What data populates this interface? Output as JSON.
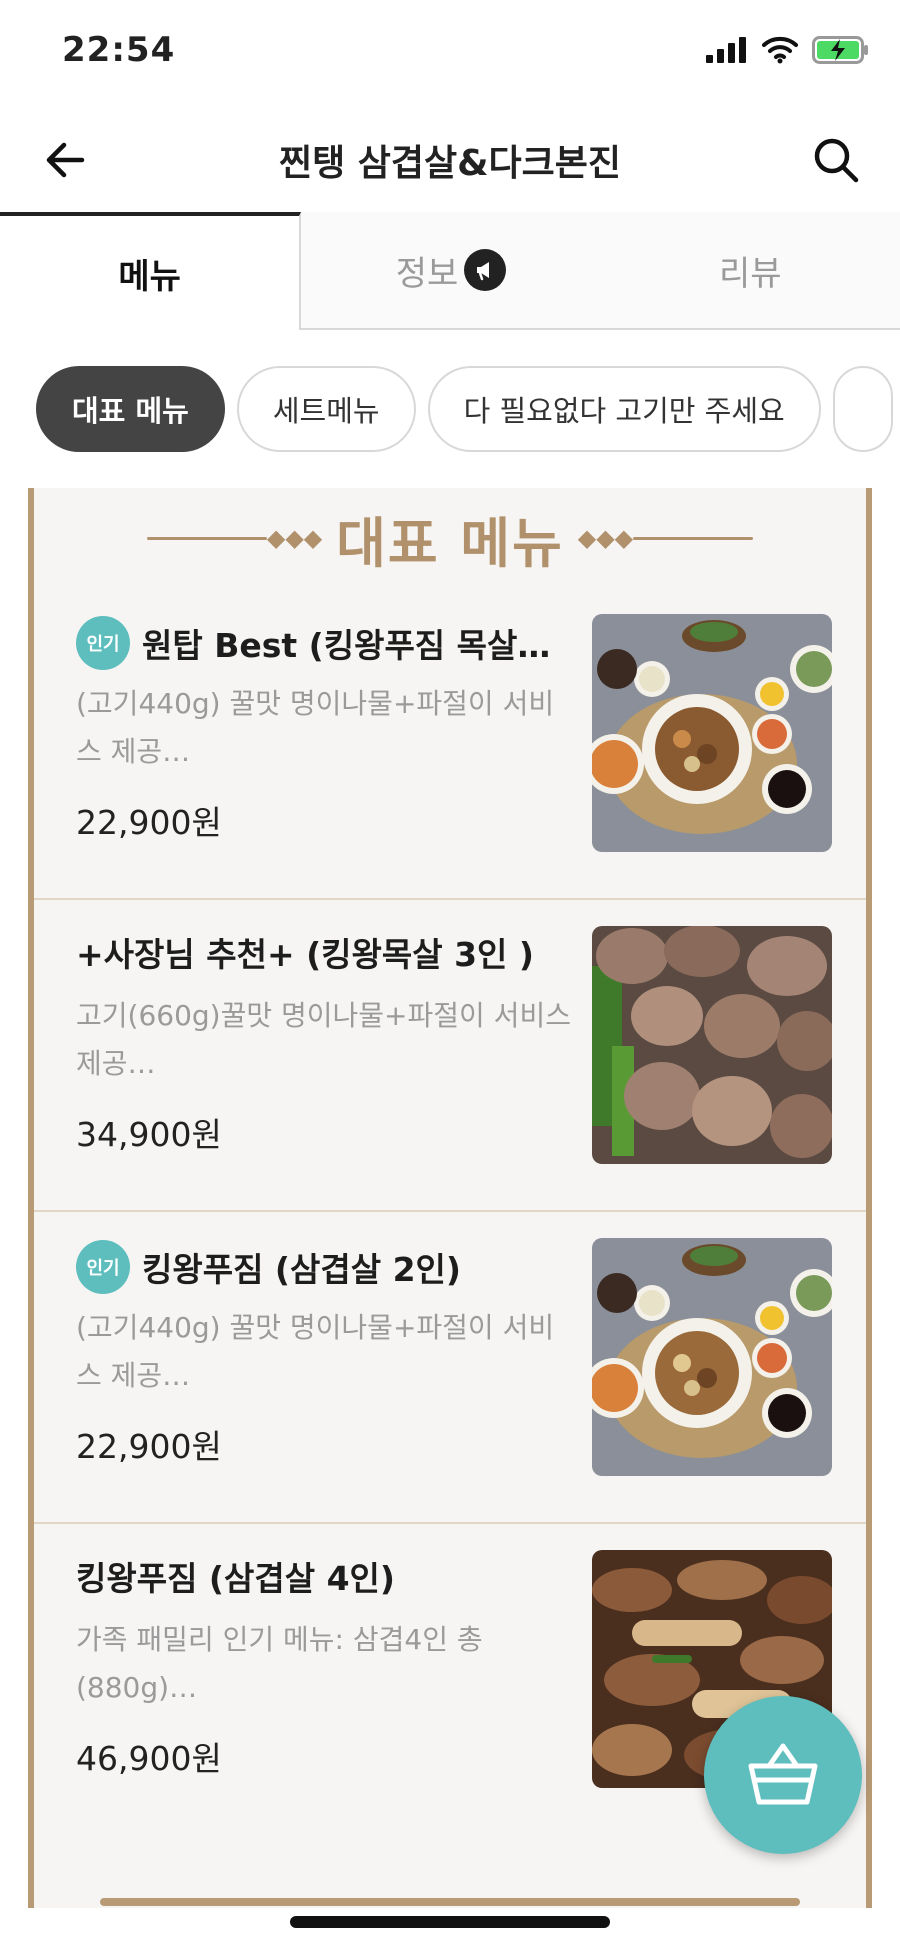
{
  "status": {
    "time": "22:54"
  },
  "header": {
    "title": "찐탱 삼겹살&다크본진"
  },
  "tabs": [
    {
      "label": "메뉴"
    },
    {
      "label": "정보"
    },
    {
      "label": "리뷰"
    }
  ],
  "chips": [
    {
      "label": "대표 메뉴"
    },
    {
      "label": "세트메뉴"
    },
    {
      "label": "다 필요없다 고기만 주세요"
    }
  ],
  "board": {
    "title": "대표 메뉴"
  },
  "colors": {
    "accent": "#5ebdbd",
    "board_gold": "#b89a74"
  },
  "items": [
    {
      "badge": "인기",
      "name": "원탑 Best (킹왕푸짐 목살…",
      "desc": "(고기440g) 꿀맛 명이나물+파절이 서비스 제공…",
      "price": "22,900원"
    },
    {
      "badge": "",
      "name": "+사장님 추천+ (킹왕목살  3인 )",
      "desc": "고기(660g)꿀맛 명이나물+파절이 서비스 제공…",
      "price": "34,900원"
    },
    {
      "badge": "인기",
      "name": "킹왕푸짐 (삼겹살 2인)",
      "desc": "(고기440g) 꿀맛 명이나물+파절이 서비스 제공…",
      "price": "22,900원"
    },
    {
      "badge": "",
      "name": "킹왕푸짐 (삼겹살 4인)",
      "desc": "가족 패밀리 인기 메뉴: 삼겹4인 총(880g)…",
      "price": "46,900원"
    }
  ]
}
